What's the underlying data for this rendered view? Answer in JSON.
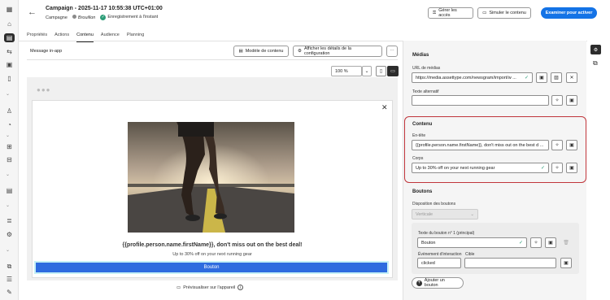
{
  "header": {
    "title": "Campaign - 2025-11-17 10:55:38 UTC+01:00",
    "type_label": "Campagne",
    "status_label": "Brouillon",
    "save_status": "Enregistrement à l'instant",
    "manage_access": "Gérer les accès",
    "simulate_content": "Simuler le contenu",
    "review_activate": "Examiner pour activer"
  },
  "tabs": [
    {
      "label": "Propriétés"
    },
    {
      "label": "Actions"
    },
    {
      "label": "Contenu"
    },
    {
      "label": "Audience"
    },
    {
      "label": "Planning"
    }
  ],
  "editor": {
    "section_label": "Message in-app",
    "content_template": "Modèle de contenu",
    "show_config": "Afficher les détails de la configuration",
    "zoom": "100 %",
    "preview_device": "Prévisualiser sur l'appareil"
  },
  "message": {
    "title": "{{profile.person.name.firstName}}, don't miss out on the best deal!",
    "body": "Up to 30% off on your next running gear",
    "button": "Bouton"
  },
  "panel": {
    "medias_title": "Médias",
    "media_url_label": "URL de médias",
    "media_url_value": "https://media.assettype.com/newsgram/import/w ...",
    "alt_text_label": "Texte alternatif",
    "alt_text_value": "",
    "content_title": "Contenu",
    "header_label": "En-tête",
    "header_value": "{{profile.person.name.firstName}}, don't miss out on the best d ...",
    "body_label": "Corps",
    "body_value": "Up to 30% off on your next running gear",
    "buttons_title": "Boutons",
    "layout_label": "Disposition des boutons",
    "layout_value": "Verticale",
    "button_text_label": "Texte du bouton n° 1 (principal)",
    "button_text_value": "Bouton",
    "interaction_label": "Évènement d'interaction",
    "interaction_value": "clicked",
    "target_label": "Cible",
    "target_value": "",
    "add_button": "Ajouter un bouton"
  },
  "colors": {
    "primary": "#1473e6",
    "highlight": "#c0353b",
    "success": "#2d9d78",
    "message_button": "#2e6bdf"
  }
}
